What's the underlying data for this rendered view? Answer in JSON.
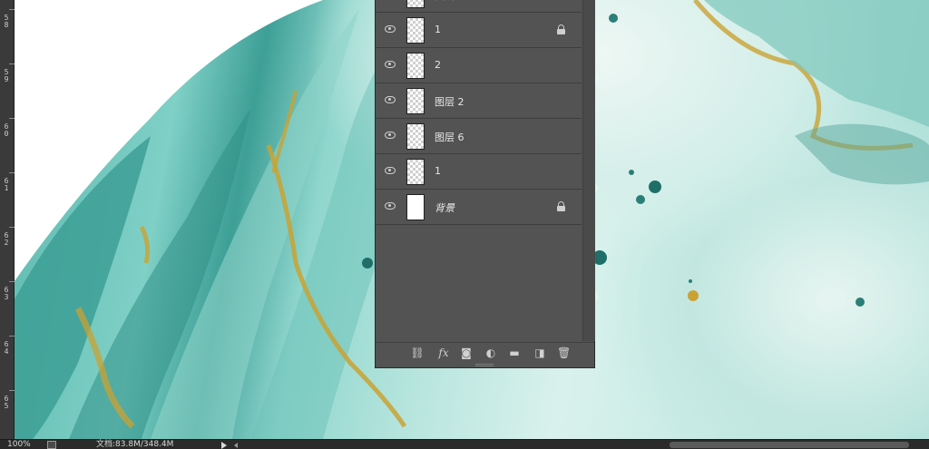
{
  "ruler": {
    "labels": [
      "5\n8",
      "5\n9",
      "6\n0",
      "6\n1",
      "6\n2",
      "6\n3",
      "6\n4",
      "6\n5"
    ]
  },
  "layers_panel": {
    "layers": [
      {
        "name": "图层",
        "locked": false,
        "visible": true,
        "thumb": "checker"
      },
      {
        "name": "1",
        "locked": true,
        "visible": true,
        "thumb": "checker"
      },
      {
        "name": "2",
        "locked": false,
        "visible": true,
        "thumb": "checker"
      },
      {
        "name": "图层 2",
        "locked": false,
        "visible": true,
        "thumb": "checker"
      },
      {
        "name": "图层 6",
        "locked": false,
        "visible": true,
        "thumb": "checker"
      },
      {
        "name": "1",
        "locked": false,
        "visible": true,
        "thumb": "checker"
      },
      {
        "name": "背景",
        "locked": true,
        "visible": true,
        "thumb": "white",
        "italic": true
      }
    ],
    "footer_icons": [
      {
        "name": "link-layers-icon",
        "glyph": "⛓"
      },
      {
        "name": "fx-icon",
        "glyph": "fx"
      },
      {
        "name": "add-mask-icon",
        "glyph": "◙"
      },
      {
        "name": "adjustment-layer-icon",
        "glyph": "◐"
      },
      {
        "name": "new-group-icon",
        "glyph": "▬"
      },
      {
        "name": "new-layer-icon",
        "glyph": "◨"
      },
      {
        "name": "delete-layer-icon",
        "glyph": "🗑"
      }
    ]
  },
  "statusbar": {
    "zoom": "100%",
    "doc_info": "文档:83.8M/348.4M"
  },
  "colors": {
    "panel_bg": "#535353",
    "statusbar_bg": "#2b2b2b",
    "marble_teal": "#4fb3a9",
    "marble_gold": "#c9a233"
  }
}
